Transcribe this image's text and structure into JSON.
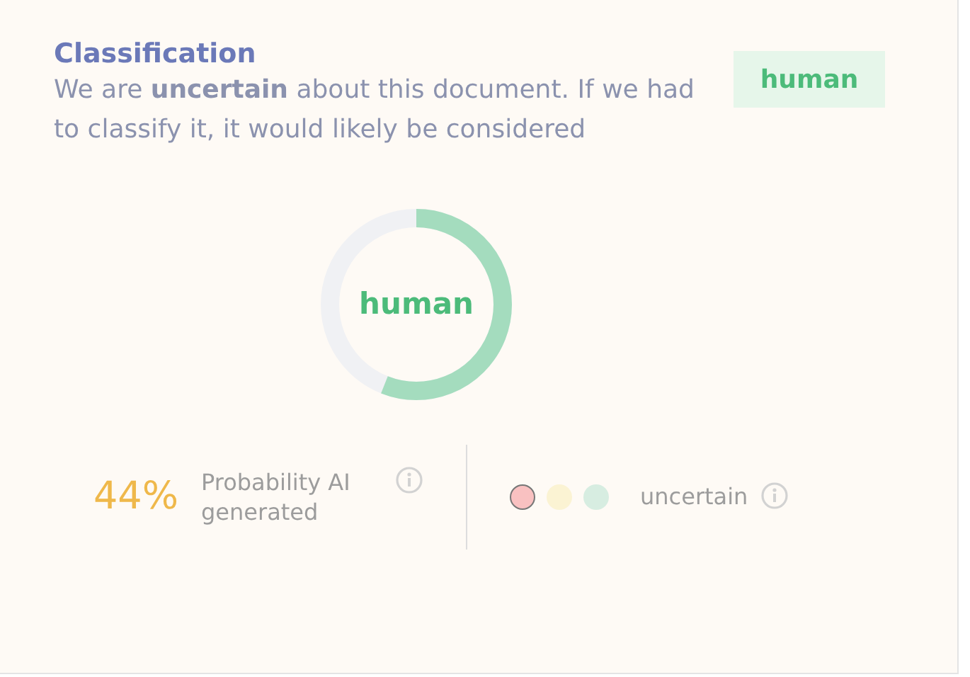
{
  "classification": {
    "title": "Classification",
    "sentence": "We are **uncertain** about this document. If we had to classify it, it would likely be considered",
    "badge": "human"
  },
  "gauge": {
    "label": "human",
    "level": 0.56
  },
  "probability": {
    "value": "44%",
    "label": "Probability AI generated"
  },
  "confidence": {
    "dots": [
      {
        "color": "#f9c1c1",
        "selected": true
      },
      {
        "color": "#fbf3d3",
        "selected": false
      },
      {
        "color": "#d7ede1",
        "selected": false
      }
    ],
    "label": "uncertain"
  }
}
